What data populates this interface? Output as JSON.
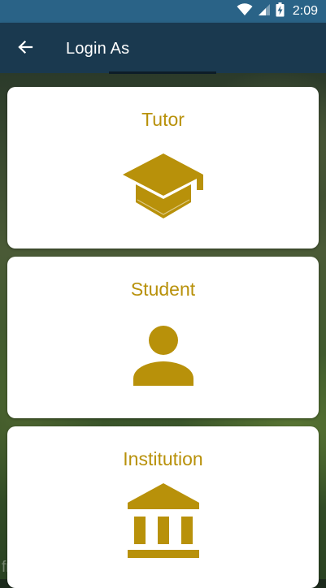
{
  "status_bar": {
    "time": "2:09",
    "icons": [
      "wifi-icon",
      "signal-icon",
      "battery-charging-icon"
    ]
  },
  "app_bar": {
    "back_icon": "arrow-back-icon",
    "title": "Login As"
  },
  "cards": [
    {
      "label": "Tutor",
      "icon": "graduation-cap-icon"
    },
    {
      "label": "Student",
      "icon": "person-icon"
    },
    {
      "label": "Institution",
      "icon": "bank-building-icon"
    }
  ],
  "watermark": "free for personal use",
  "colors": {
    "status_bar": "#2a6387",
    "app_bar": "#1a394f",
    "accent": "#b8910a",
    "card_bg": "#ffffff"
  }
}
